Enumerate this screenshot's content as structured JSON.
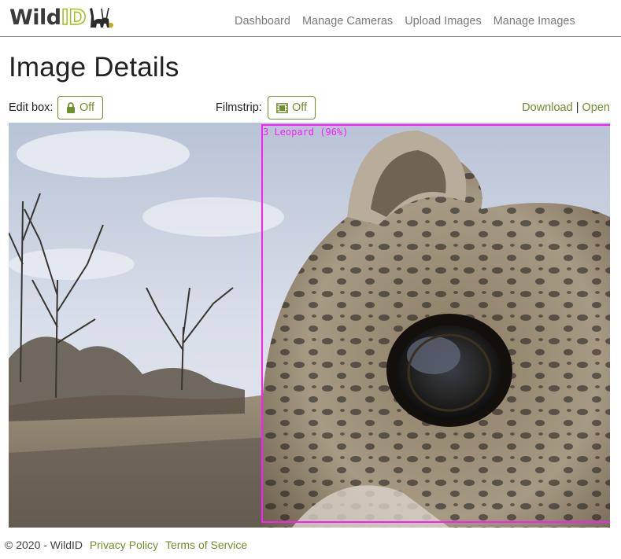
{
  "brand": {
    "wild": "Wild",
    "id": "ID",
    "animals_icon": "wildlife-silhouettes-icon"
  },
  "nav": {
    "items": [
      {
        "label": "Dashboard"
      },
      {
        "label": "Manage Cameras"
      },
      {
        "label": "Upload Images"
      },
      {
        "label": "Manage Images"
      }
    ]
  },
  "page": {
    "title": "Image Details"
  },
  "controls": {
    "edit_box_label": "Edit box:",
    "edit_box_state": "Off",
    "edit_box_icon": "lock-icon",
    "filmstrip_label": "Filmstrip:",
    "filmstrip_state": "Off",
    "filmstrip_icon": "film-icon",
    "download_label": "Download",
    "separator": "|",
    "open_label": "Open"
  },
  "image": {
    "detection": {
      "label": "3 Leopard (96%)",
      "color": "#ff1aff"
    }
  },
  "footer": {
    "copyright": "© 2020 - WildID",
    "privacy": "Privacy Policy",
    "terms": "Terms of Service"
  },
  "colors": {
    "accent": "#6f8f2a",
    "logo_green": "#9fbf1a",
    "box": "#ff1aff"
  }
}
